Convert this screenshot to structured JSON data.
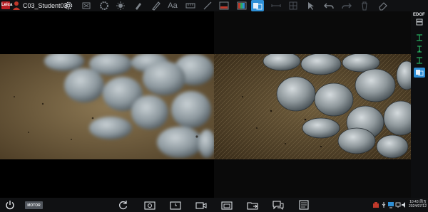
{
  "app": {
    "logo_text": "Leica",
    "user_name": "C03_Student03"
  },
  "toolbar": {
    "items": [
      {
        "icon": "settings-gear-icon"
      },
      {
        "icon": "fit-frame-icon"
      },
      {
        "icon": "color-wheel-icon"
      },
      {
        "icon": "brightness-icon"
      },
      {
        "icon": "pen-icon"
      },
      {
        "icon": "text-annotation-icon",
        "label": "Aa"
      },
      {
        "icon": "ruler-icon"
      },
      {
        "icon": "line-measure-icon"
      },
      {
        "icon": "image-filter-icon"
      },
      {
        "icon": "palette-icon"
      },
      {
        "icon": "compare-split-icon",
        "active": true
      },
      {
        "icon": "distance-icon"
      },
      {
        "icon": "grid-icon"
      },
      {
        "icon": "pointer-icon"
      },
      {
        "icon": "undo-icon"
      },
      {
        "icon": "redo-icon"
      },
      {
        "icon": "delete-icon"
      },
      {
        "icon": "eraser-icon"
      }
    ]
  },
  "sidebar": {
    "edof_label": "EDOF",
    "items": [
      {
        "icon": "edof-stack-icon"
      },
      {
        "icon": "focus-top-icon"
      },
      {
        "icon": "focus-middle-icon"
      },
      {
        "icon": "focus-bottom-icon"
      },
      {
        "icon": "compare-split-icon",
        "active": true
      }
    ]
  },
  "bottom": {
    "motor_label": "MOTOR",
    "items": [
      {
        "icon": "power-icon"
      },
      {
        "icon": "refresh-icon"
      },
      {
        "icon": "snapshot-icon"
      },
      {
        "icon": "timed-capture-icon"
      },
      {
        "icon": "video-record-icon"
      },
      {
        "icon": "gallery-icon"
      },
      {
        "icon": "folder-export-icon"
      },
      {
        "icon": "chat-icon"
      },
      {
        "icon": "report-icon"
      }
    ],
    "tray": [
      {
        "icon": "camera-status-icon",
        "color": "#c0392b"
      },
      {
        "icon": "usb-icon"
      },
      {
        "icon": "monitor-icon",
        "color": "#2e8fd6"
      },
      {
        "icon": "network-icon"
      },
      {
        "icon": "volume-icon"
      }
    ],
    "time": "10:43 周五",
    "date": "2024/07/12"
  },
  "colors": {
    "accent": "#2e8fd6",
    "brand": "#b81e24",
    "background": "#0d0e10"
  },
  "content": {
    "left_view": "live microscope view (blurred focus)",
    "right_view": "EDOF processed image (sharp focus)"
  }
}
